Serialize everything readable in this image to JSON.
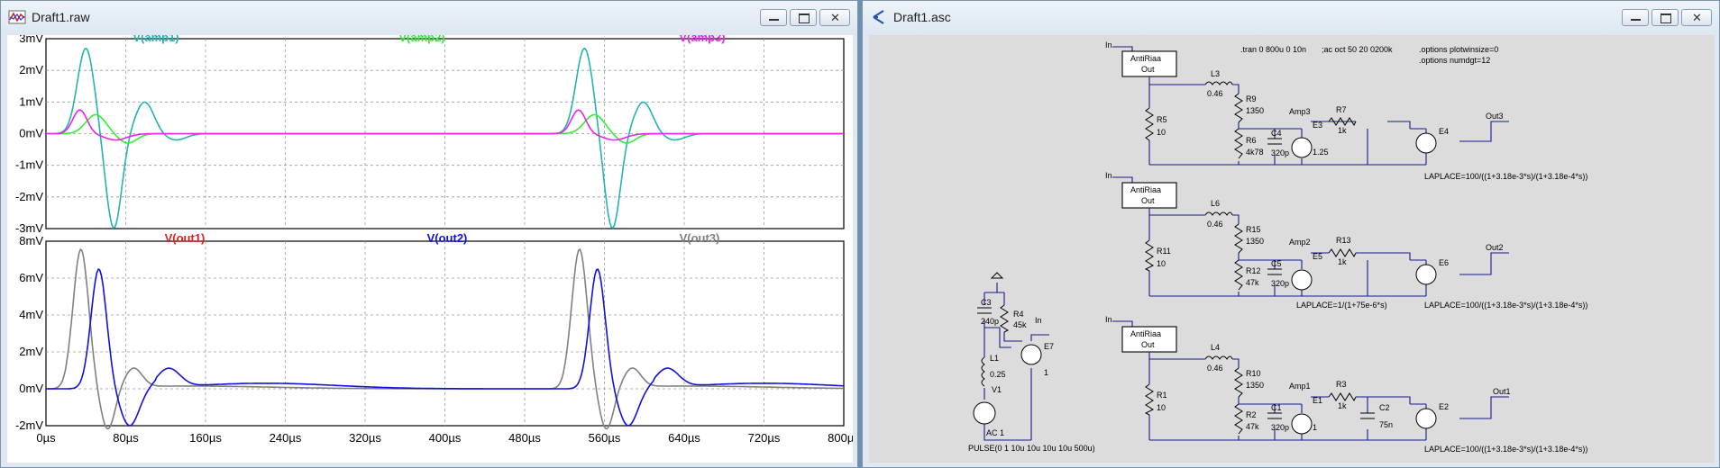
{
  "colors": {
    "amp1": "#22b4b4",
    "amp2": "#33ee33",
    "amp3": "#ee22ee",
    "out1": "#e0201e",
    "out2": "#1010e0",
    "out3": "#808080",
    "wire": "#1a1a8c"
  },
  "waveform_window": {
    "title": "Draft1.raw",
    "top_plot": {
      "traces": [
        "V(amp1)",
        "V(amp2)",
        "V(amp3)"
      ],
      "y_ticks": [
        "3mV",
        "2mV",
        "1mV",
        "0mV",
        "-1mV",
        "-2mV",
        "-3mV"
      ]
    },
    "bottom_plot": {
      "traces": [
        "V(out1)",
        "V(out2)",
        "V(out3)"
      ],
      "y_ticks": [
        "8mV",
        "6mV",
        "4mV",
        "2mV",
        "0mV",
        "-2mV"
      ]
    },
    "x_ticks": [
      "0µs",
      "80µs",
      "160µs",
      "240µs",
      "320µs",
      "400µs",
      "480µs",
      "560µs",
      "640µs",
      "720µs",
      "800µs"
    ]
  },
  "schematic_window": {
    "title": "Draft1.asc",
    "directives": [
      ".tran 0 800u 0 10n",
      ";ac oct 50 20 0200k",
      ".options plotwinsize=0",
      ".options numdgt=12"
    ],
    "stage3": {
      "in": "In",
      "block": "AntiRiaa",
      "block_out": "Out",
      "l": "L3",
      "l_val": "0.46",
      "r_s": "R9",
      "r_s_val": "1350",
      "r_sh": "R5",
      "r_sh_val": "10",
      "r_p": "R6",
      "r_p_val": "4k78",
      "c": "C4",
      "c_val": "320p",
      "amp": "E3",
      "amp_gain": "1.25",
      "net": "Amp3",
      "r_o": "R7",
      "r_o_val": "1k",
      "e_out": "E4",
      "out": "Out3",
      "laplace": "LAPLACE=100/((1+3.18e-3*s)/(1+3.18e-4*s))"
    },
    "stage2": {
      "in": "In",
      "block": "AntiRiaa",
      "block_out": "Out",
      "l": "L6",
      "l_val": "0.46",
      "r_s": "R15",
      "r_s_val": "1350",
      "r_sh": "R11",
      "r_sh_val": "10",
      "r_p": "R12",
      "r_p_val": "47k",
      "c": "C5",
      "c_val": "320p",
      "amp": "E5",
      "net": "Amp2",
      "r_o": "R13",
      "r_o_val": "1k",
      "e_out": "E6",
      "out": "Out2",
      "laplace_mid": "LAPLACE=1/(1+75e-6*s)",
      "laplace": "LAPLACE=100/((1+3.18e-3*s)/(1+3.18e-4*s))"
    },
    "stage1": {
      "in": "In",
      "block": "AntiRiaa",
      "block_out": "Out",
      "l": "L4",
      "l_val": "0.46",
      "r_s": "R10",
      "r_s_val": "1350",
      "r_sh": "R1",
      "r_sh_val": "10",
      "r_p": "R2",
      "r_p_val": "47k",
      "c": "C1",
      "c_val": "320p",
      "amp": "E1",
      "amp_gain": "1",
      "net": "Amp1",
      "r_o": "R3",
      "r_o_val": "1k",
      "c2": "C2",
      "c2_val": "75n",
      "e_out": "E2",
      "out": "Out1",
      "laplace": "LAPLACE=100/((1+3.18e-3*s)/(1+3.18e-4*s))"
    },
    "source": {
      "c3": "C3",
      "c3_val": "240p",
      "r4": "R4",
      "r4_val": "45k",
      "in": "In",
      "e7": "E7",
      "e7_gain": "1",
      "l1": "L1",
      "l1_val": "0.25",
      "v1": "V1",
      "ac": "AC 1",
      "pulse": "PULSE(0 1 10u 10u 10u 10u 500u)"
    }
  }
}
